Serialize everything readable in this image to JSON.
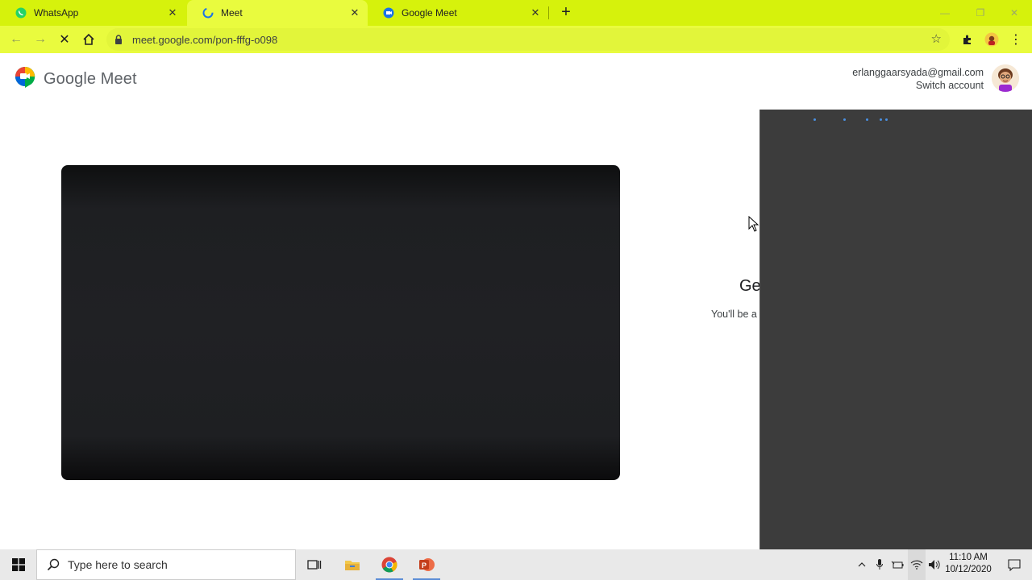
{
  "browser": {
    "tabs": [
      {
        "title": "WhatsApp",
        "icon": "whatsapp-icon",
        "active": false
      },
      {
        "title": "Meet",
        "icon": "loading-icon",
        "active": true
      },
      {
        "title": "Google Meet",
        "icon": "google-meet-icon",
        "active": false
      }
    ],
    "url": "meet.google.com/pon-fffg-o098",
    "colors": {
      "theme": "#d6f20c",
      "active_tab": "#e9fb3e"
    }
  },
  "page": {
    "logo_text": "Google Meet",
    "account_email": "erlanggaarsyada@gmail.com",
    "switch_account": "Switch account",
    "join_title_partial": "Ge",
    "join_subtitle_partial": "You'll be a"
  },
  "taskbar": {
    "search_placeholder": "Type here to search",
    "time": "11:10 AM",
    "date": "10/12/2020"
  }
}
